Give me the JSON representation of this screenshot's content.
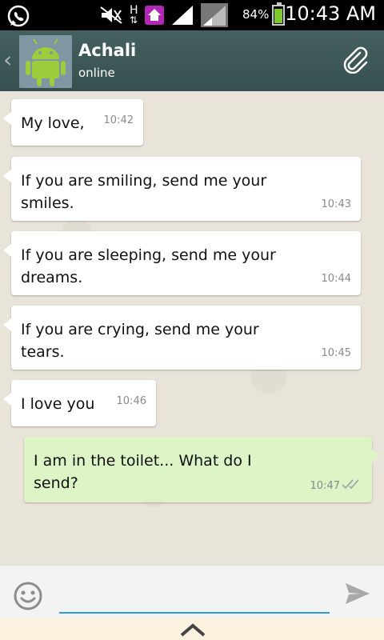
{
  "status_bar": {
    "network_type": "H",
    "battery_percent": "84%",
    "battery_level": 0.84,
    "time": "10:43 AM"
  },
  "header": {
    "back_icon": "chevron-left-icon",
    "contact_name": "Achali",
    "contact_status": "online",
    "attach_icon": "paperclip-icon"
  },
  "messages": [
    {
      "direction": "in",
      "text_lines": [
        "My love,"
      ],
      "time": "10:42"
    },
    {
      "direction": "in",
      "text_lines": [
        "If you are smiling, send me your",
        "smiles."
      ],
      "time": "10:43"
    },
    {
      "direction": "in",
      "text_lines": [
        "If you are sleeping, send me your",
        "dreams."
      ],
      "time": "10:44"
    },
    {
      "direction": "in",
      "text_lines": [
        "If you are crying, send me your",
        "tears."
      ],
      "time": "10:45"
    },
    {
      "direction": "in",
      "text_lines": [
        "I love you"
      ],
      "time": "10:46"
    },
    {
      "direction": "out",
      "text_lines": [
        "I am in the toilet... What do I",
        "send?"
      ],
      "time": "10:47",
      "delivered": true
    }
  ],
  "input_bar": {
    "emoji_icon": "smiley-icon",
    "message_value": "",
    "send_icon": "send-icon"
  },
  "colors": {
    "header_bg": "#3e5a5c",
    "chat_bg": "#e9e4da",
    "outgoing_bubble": "#ddf5c6",
    "input_underline": "#2a9fd6"
  }
}
